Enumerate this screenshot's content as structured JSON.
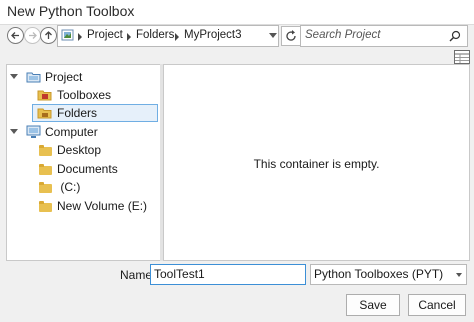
{
  "window": {
    "title": "New Python Toolbox"
  },
  "nav": {
    "path_segments": [
      "Project",
      "Folders",
      "MyProject3"
    ],
    "search_placeholder": "Search Project"
  },
  "tree": {
    "items": [
      {
        "label": "Project",
        "icon": "project-folder-icon",
        "expanded": true
      },
      {
        "label": "Toolboxes",
        "icon": "toolboxes-folder-icon"
      },
      {
        "label": "Folders",
        "icon": "folders-icon",
        "selected": true
      },
      {
        "label": "Computer",
        "icon": "computer-icon",
        "expanded": true
      },
      {
        "label": "Desktop",
        "icon": "folder-icon"
      },
      {
        "label": "Documents",
        "icon": "folder-icon"
      },
      {
        "label": " (C:)",
        "icon": "folder-icon"
      },
      {
        "label": "New Volume (E:)",
        "icon": "folder-icon"
      }
    ]
  },
  "content": {
    "empty_message": "This container is empty."
  },
  "footer": {
    "name_label": "Name",
    "name_value": "ToolTest1",
    "type_value": "Python Toolboxes (PYT)",
    "save_label": "Save",
    "cancel_label": "Cancel"
  },
  "colors": {
    "selection": "#e6f0fa",
    "selection_border": "#70aee3",
    "focus_border": "#3c8fd6"
  }
}
